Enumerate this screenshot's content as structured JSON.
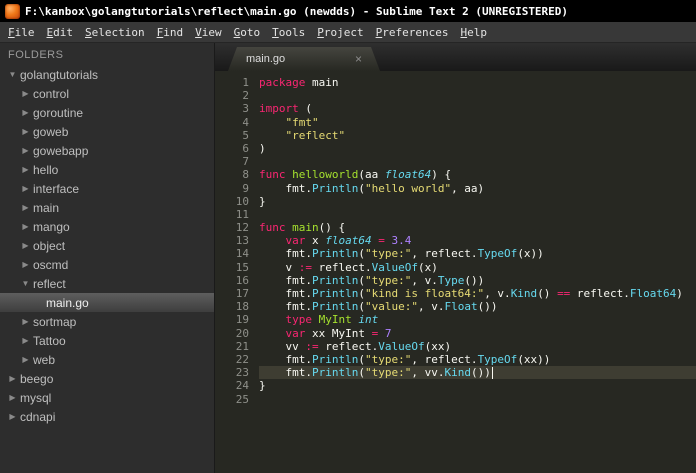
{
  "window": {
    "title": "F:\\kanbox\\golangtutorials\\reflect\\main.go (newdds) - Sublime Text 2 (UNREGISTERED)"
  },
  "menu": {
    "items": [
      "File",
      "Edit",
      "Selection",
      "Find",
      "View",
      "Goto",
      "Tools",
      "Project",
      "Preferences",
      "Help"
    ]
  },
  "sidebar": {
    "header": "FOLDERS",
    "items": [
      {
        "label": "golangtutorials",
        "depth": 0,
        "type": "folder",
        "state": "expanded"
      },
      {
        "label": "control",
        "depth": 1,
        "type": "folder",
        "state": "collapsed"
      },
      {
        "label": "goroutine",
        "depth": 1,
        "type": "folder",
        "state": "collapsed"
      },
      {
        "label": "goweb",
        "depth": 1,
        "type": "folder",
        "state": "collapsed"
      },
      {
        "label": "gowebapp",
        "depth": 1,
        "type": "folder",
        "state": "collapsed"
      },
      {
        "label": "hello",
        "depth": 1,
        "type": "folder",
        "state": "collapsed"
      },
      {
        "label": "interface",
        "depth": 1,
        "type": "folder",
        "state": "collapsed"
      },
      {
        "label": "main",
        "depth": 1,
        "type": "folder",
        "state": "collapsed"
      },
      {
        "label": "mango",
        "depth": 1,
        "type": "folder",
        "state": "collapsed"
      },
      {
        "label": "object",
        "depth": 1,
        "type": "folder",
        "state": "collapsed"
      },
      {
        "label": "oscmd",
        "depth": 1,
        "type": "folder",
        "state": "collapsed"
      },
      {
        "label": "reflect",
        "depth": 1,
        "type": "folder",
        "state": "expanded"
      },
      {
        "label": "main.go",
        "depth": 2,
        "type": "file",
        "selected": true
      },
      {
        "label": "sortmap",
        "depth": 1,
        "type": "folder",
        "state": "collapsed"
      },
      {
        "label": "Tattoo",
        "depth": 1,
        "type": "folder",
        "state": "collapsed"
      },
      {
        "label": "web",
        "depth": 1,
        "type": "folder",
        "state": "collapsed"
      },
      {
        "label": "beego",
        "depth": 0,
        "type": "folder",
        "state": "collapsed"
      },
      {
        "label": "mysql",
        "depth": 0,
        "type": "folder",
        "state": "collapsed"
      },
      {
        "label": "cdnapi",
        "depth": 0,
        "type": "folder",
        "state": "collapsed"
      }
    ]
  },
  "tab": {
    "label": "main.go",
    "close_glyph": "×"
  },
  "editor": {
    "lines": [
      {
        "num": 1,
        "tokens": [
          [
            "kw",
            "package"
          ],
          [
            "pl",
            " main"
          ]
        ]
      },
      {
        "num": 2,
        "tokens": []
      },
      {
        "num": 3,
        "tokens": [
          [
            "kw",
            "import"
          ],
          [
            "pl",
            " ("
          ]
        ]
      },
      {
        "num": 4,
        "tokens": [
          [
            "pl",
            "    "
          ],
          [
            "str",
            "\"fmt\""
          ]
        ]
      },
      {
        "num": 5,
        "tokens": [
          [
            "pl",
            "    "
          ],
          [
            "str",
            "\"reflect\""
          ]
        ]
      },
      {
        "num": 6,
        "tokens": [
          [
            "pl",
            ")"
          ]
        ]
      },
      {
        "num": 7,
        "tokens": []
      },
      {
        "num": 8,
        "tokens": [
          [
            "kw",
            "func"
          ],
          [
            "pl",
            " "
          ],
          [
            "fn",
            "helloworld"
          ],
          [
            "pl",
            "(aa "
          ],
          [
            "typ",
            "float64"
          ],
          [
            "pl",
            ") {"
          ]
        ]
      },
      {
        "num": 9,
        "tokens": [
          [
            "pl",
            "    fmt."
          ],
          [
            "call",
            "Println"
          ],
          [
            "pl",
            "("
          ],
          [
            "str",
            "\"hello world\""
          ],
          [
            "pl",
            ", aa)"
          ]
        ]
      },
      {
        "num": 10,
        "tokens": [
          [
            "pl",
            "}"
          ]
        ]
      },
      {
        "num": 11,
        "tokens": []
      },
      {
        "num": 12,
        "tokens": [
          [
            "kw",
            "func"
          ],
          [
            "pl",
            " "
          ],
          [
            "fn",
            "main"
          ],
          [
            "pl",
            "() {"
          ]
        ]
      },
      {
        "num": 13,
        "tokens": [
          [
            "pl",
            "    "
          ],
          [
            "kw",
            "var"
          ],
          [
            "pl",
            " x "
          ],
          [
            "typ",
            "float64"
          ],
          [
            "pl",
            " "
          ],
          [
            "kw",
            "="
          ],
          [
            "pl",
            " "
          ],
          [
            "num",
            "3.4"
          ]
        ]
      },
      {
        "num": 14,
        "tokens": [
          [
            "pl",
            "    fmt."
          ],
          [
            "call",
            "Println"
          ],
          [
            "pl",
            "("
          ],
          [
            "str",
            "\"type:\""
          ],
          [
            "pl",
            ", reflect."
          ],
          [
            "call",
            "TypeOf"
          ],
          [
            "pl",
            "(x))"
          ]
        ]
      },
      {
        "num": 15,
        "tokens": [
          [
            "pl",
            "    v "
          ],
          [
            "kw",
            ":="
          ],
          [
            "pl",
            " reflect."
          ],
          [
            "call",
            "ValueOf"
          ],
          [
            "pl",
            "(x)"
          ]
        ]
      },
      {
        "num": 16,
        "tokens": [
          [
            "pl",
            "    fmt."
          ],
          [
            "call",
            "Println"
          ],
          [
            "pl",
            "("
          ],
          [
            "str",
            "\"type:\""
          ],
          [
            "pl",
            ", v."
          ],
          [
            "call",
            "Type"
          ],
          [
            "pl",
            "())"
          ]
        ]
      },
      {
        "num": 17,
        "tokens": [
          [
            "pl",
            "    fmt."
          ],
          [
            "call",
            "Println"
          ],
          [
            "pl",
            "("
          ],
          [
            "str",
            "\"kind is float64:\""
          ],
          [
            "pl",
            ", v."
          ],
          [
            "call",
            "Kind"
          ],
          [
            "pl",
            "() "
          ],
          [
            "kw",
            "=="
          ],
          [
            "pl",
            " reflect."
          ],
          [
            "call",
            "Float64"
          ],
          [
            "pl",
            ")"
          ]
        ]
      },
      {
        "num": 18,
        "tokens": [
          [
            "pl",
            "    fmt."
          ],
          [
            "call",
            "Println"
          ],
          [
            "pl",
            "("
          ],
          [
            "str",
            "\"value:\""
          ],
          [
            "pl",
            ", v."
          ],
          [
            "call",
            "Float"
          ],
          [
            "pl",
            "())"
          ]
        ]
      },
      {
        "num": 19,
        "tokens": [
          [
            "pl",
            "    "
          ],
          [
            "kw",
            "type"
          ],
          [
            "pl",
            " "
          ],
          [
            "fn",
            "MyInt"
          ],
          [
            "pl",
            " "
          ],
          [
            "typ",
            "int"
          ]
        ]
      },
      {
        "num": 20,
        "tokens": [
          [
            "pl",
            "    "
          ],
          [
            "kw",
            "var"
          ],
          [
            "pl",
            " xx MyInt "
          ],
          [
            "kw",
            "="
          ],
          [
            "pl",
            " "
          ],
          [
            "num",
            "7"
          ]
        ]
      },
      {
        "num": 21,
        "tokens": [
          [
            "pl",
            "    vv "
          ],
          [
            "kw",
            ":="
          ],
          [
            "pl",
            " reflect."
          ],
          [
            "call",
            "ValueOf"
          ],
          [
            "pl",
            "(xx)"
          ]
        ]
      },
      {
        "num": 22,
        "tokens": [
          [
            "pl",
            "    fmt."
          ],
          [
            "call",
            "Println"
          ],
          [
            "pl",
            "("
          ],
          [
            "str",
            "\"type:\""
          ],
          [
            "pl",
            ", reflect."
          ],
          [
            "call",
            "TypeOf"
          ],
          [
            "pl",
            "(xx))"
          ]
        ]
      },
      {
        "num": 23,
        "tokens": [
          [
            "pl",
            "    fmt."
          ],
          [
            "call",
            "Println"
          ],
          [
            "pl",
            "("
          ],
          [
            "str",
            "\"type:\""
          ],
          [
            "pl",
            ", vv."
          ],
          [
            "call",
            "Kind"
          ],
          [
            "pl",
            "())"
          ]
        ],
        "current": true,
        "cursor": true
      },
      {
        "num": 24,
        "tokens": [
          [
            "pl",
            "}"
          ]
        ]
      },
      {
        "num": 25,
        "tokens": []
      }
    ]
  },
  "theme": {
    "bg_editor": "#272822",
    "bg_sidebar": "#2d2d2d",
    "bg_titlebar": "#000000",
    "bg_menubar": "#383838",
    "fg_code": "#f8f8f2",
    "gutter": "#8f908a",
    "current_line": "#3e3d32",
    "kw": "#f92672",
    "str": "#e6db74",
    "num": "#ae81ff",
    "typ": "#66d9ef",
    "call": "#66d9ef",
    "fndef": "#a6e22e"
  }
}
